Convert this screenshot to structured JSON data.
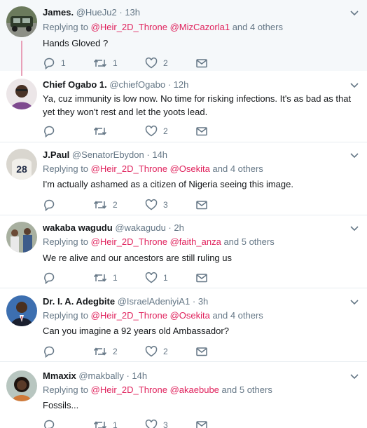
{
  "tweets": [
    {
      "name": "James.",
      "handle": "@HueJu2",
      "separator": "·",
      "time": "13h",
      "replying_prefix": "Replying to",
      "mentions": [
        "@Heir_2D_Throne",
        "@MizCazorla1"
      ],
      "others": "and 4 others",
      "text": "Hands Gloved ?",
      "replies": "1",
      "retweets": "1",
      "likes": "2"
    },
    {
      "name": "Chief Ogabo 1.",
      "handle": "@chiefOgabo",
      "separator": "·",
      "time": "12h",
      "text": "Ya, cuz immunity is low now. No time for risking infections. It's as bad as that yet they won't rest and let the yoots lead.",
      "replies": "",
      "retweets": "",
      "likes": "2"
    },
    {
      "name": "J.Paul",
      "handle": "@SenatorEbydon",
      "separator": "·",
      "time": "14h",
      "replying_prefix": "Replying to",
      "mentions": [
        "@Heir_2D_Throne",
        "@Osekita"
      ],
      "others": "and 4 others",
      "text": "I'm actually ashamed as a citizen of Nigeria seeing this image.",
      "replies": "",
      "retweets": "2",
      "likes": "3",
      "avatar_text": "28"
    },
    {
      "name": "wakaba wagudu",
      "handle": "@wakagudu",
      "separator": "·",
      "time": "2h",
      "replying_prefix": "Replying to",
      "mentions": [
        "@Heir_2D_Throne",
        "@faith_anza"
      ],
      "others": "and 5 others",
      "text": "We re alive and our ancestors are still ruling us",
      "replies": "",
      "retweets": "1",
      "likes": "1"
    },
    {
      "name": "Dr. I. A. Adegbite",
      "handle": "@IsraelAdeniyiA1",
      "separator": "·",
      "time": "3h",
      "replying_prefix": "Replying to",
      "mentions": [
        "@Heir_2D_Throne",
        "@Osekita"
      ],
      "others": "and 4 others",
      "text": "Can you imagine a 92 years old Ambassador?",
      "replies": "",
      "retweets": "2",
      "likes": "2"
    },
    {
      "name": "Mmaxix",
      "handle": "@makbally",
      "separator": "·",
      "time": "14h",
      "replying_prefix": "Replying to",
      "mentions": [
        "@Heir_2D_Throne",
        "@akaebube"
      ],
      "others": "and 5 others",
      "text": "Fossils...",
      "replies": "",
      "retweets": "1",
      "likes": "3"
    }
  ],
  "colors": {
    "accent": "#e0245e",
    "muted": "#657786",
    "text": "#14171a",
    "thread_line": "#e8a0b8",
    "highlight_bg": "#f5f8fa"
  },
  "icons": {
    "reply": "reply-icon",
    "retweet": "retweet-icon",
    "like": "heart-icon",
    "dm": "envelope-icon",
    "more": "chevron-down-icon"
  }
}
